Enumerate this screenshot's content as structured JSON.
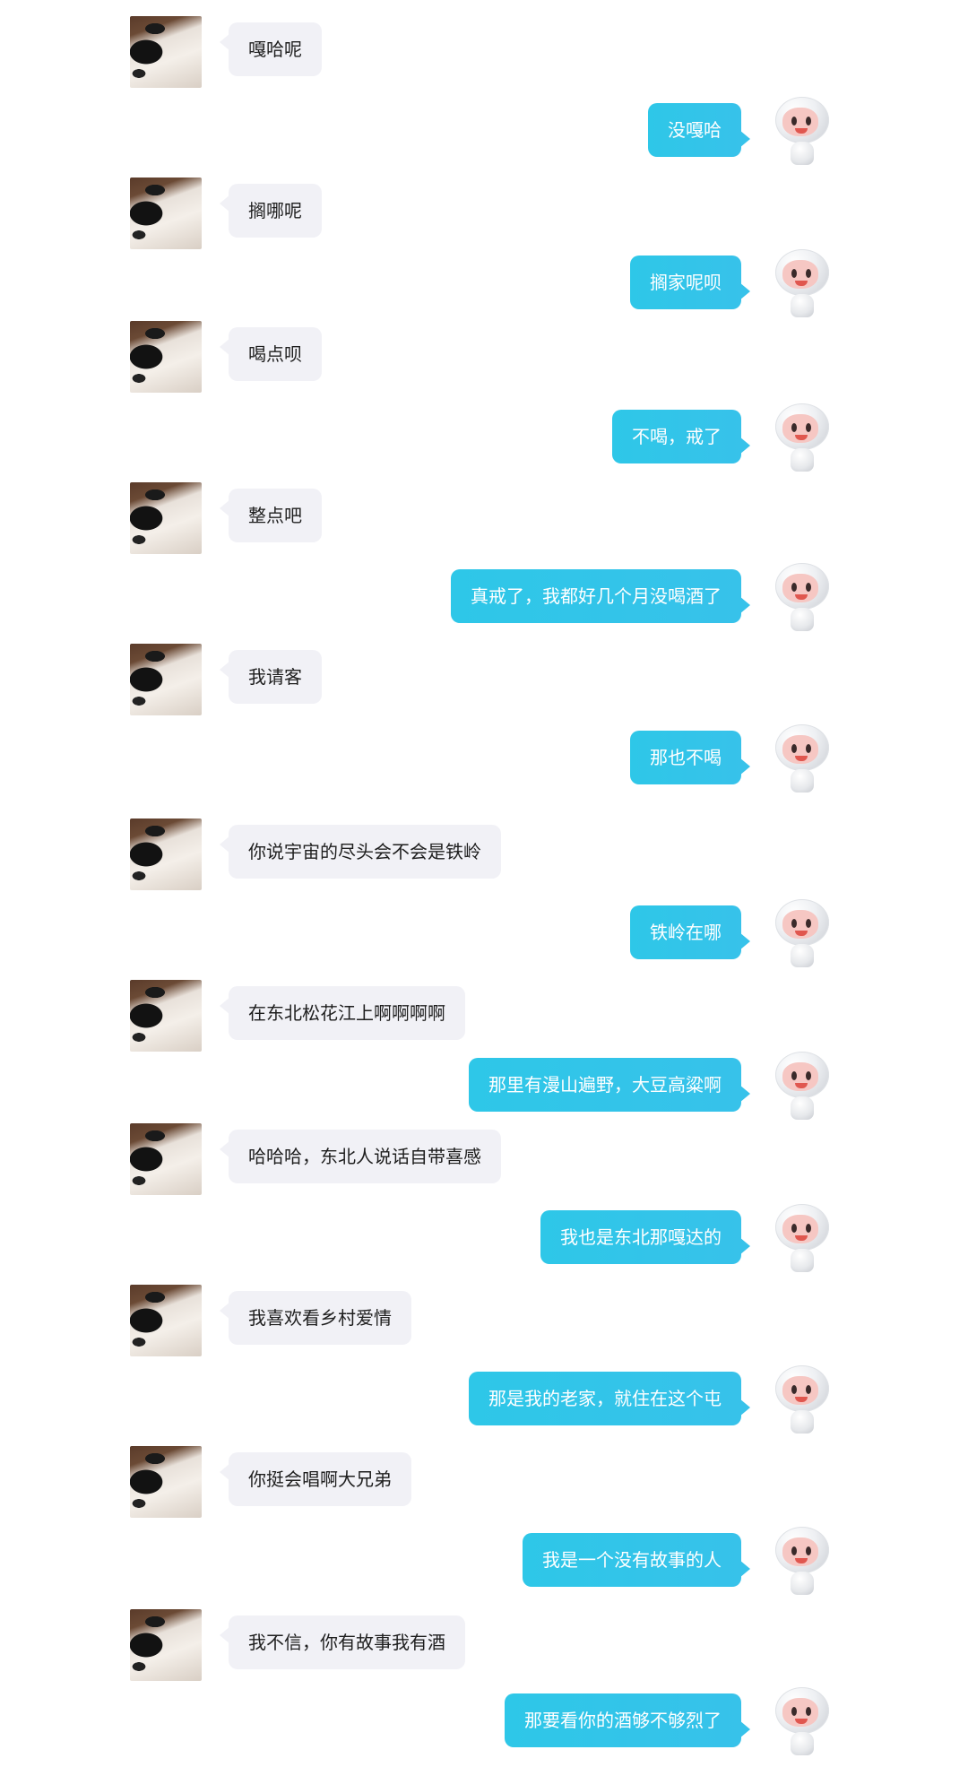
{
  "chat": {
    "messages": [
      {
        "side": "left",
        "text": "嘎哈呢"
      },
      {
        "side": "right",
        "text": "没嘎哈"
      },
      {
        "side": "left",
        "text": "搁哪呢"
      },
      {
        "side": "right",
        "text": "搁家呢呗"
      },
      {
        "side": "left",
        "text": "喝点呗"
      },
      {
        "side": "right",
        "text": "不喝，戒了"
      },
      {
        "side": "left",
        "text": "整点吧"
      },
      {
        "side": "right",
        "text": "真戒了，我都好几个月没喝酒了"
      },
      {
        "side": "left",
        "text": "我请客"
      },
      {
        "side": "right",
        "text": "那也不喝"
      },
      {
        "side": "left",
        "text": "你说宇宙的尽头会不会是铁岭"
      },
      {
        "side": "right",
        "text": "铁岭在哪"
      },
      {
        "side": "left",
        "text": "在东北松花江上啊啊啊啊"
      },
      {
        "side": "right",
        "text": "那里有漫山遍野，大豆高粱啊"
      },
      {
        "side": "left",
        "text": "哈哈哈，东北人说话自带喜感"
      },
      {
        "side": "right",
        "text": "我也是东北那嘎达的"
      },
      {
        "side": "left",
        "text": "我喜欢看乡村爱情"
      },
      {
        "side": "right",
        "text": "那是我的老家，就住在这个屯"
      },
      {
        "side": "left",
        "text": "你挺会唱啊大兄弟"
      },
      {
        "side": "right",
        "text": "我是一个没有故事的人"
      },
      {
        "side": "left",
        "text": "我不信，你有故事我有酒"
      },
      {
        "side": "right",
        "text": "那要看你的酒够不够烈了"
      }
    ]
  },
  "colors": {
    "user_bubble": "#f1f1f6",
    "bot_bubble": "#37c2ea",
    "user_text": "#1e1e1e",
    "bot_text": "#ffffff"
  },
  "icons": {
    "user_avatar": "cat-avatar",
    "bot_avatar": "robot-avatar"
  }
}
